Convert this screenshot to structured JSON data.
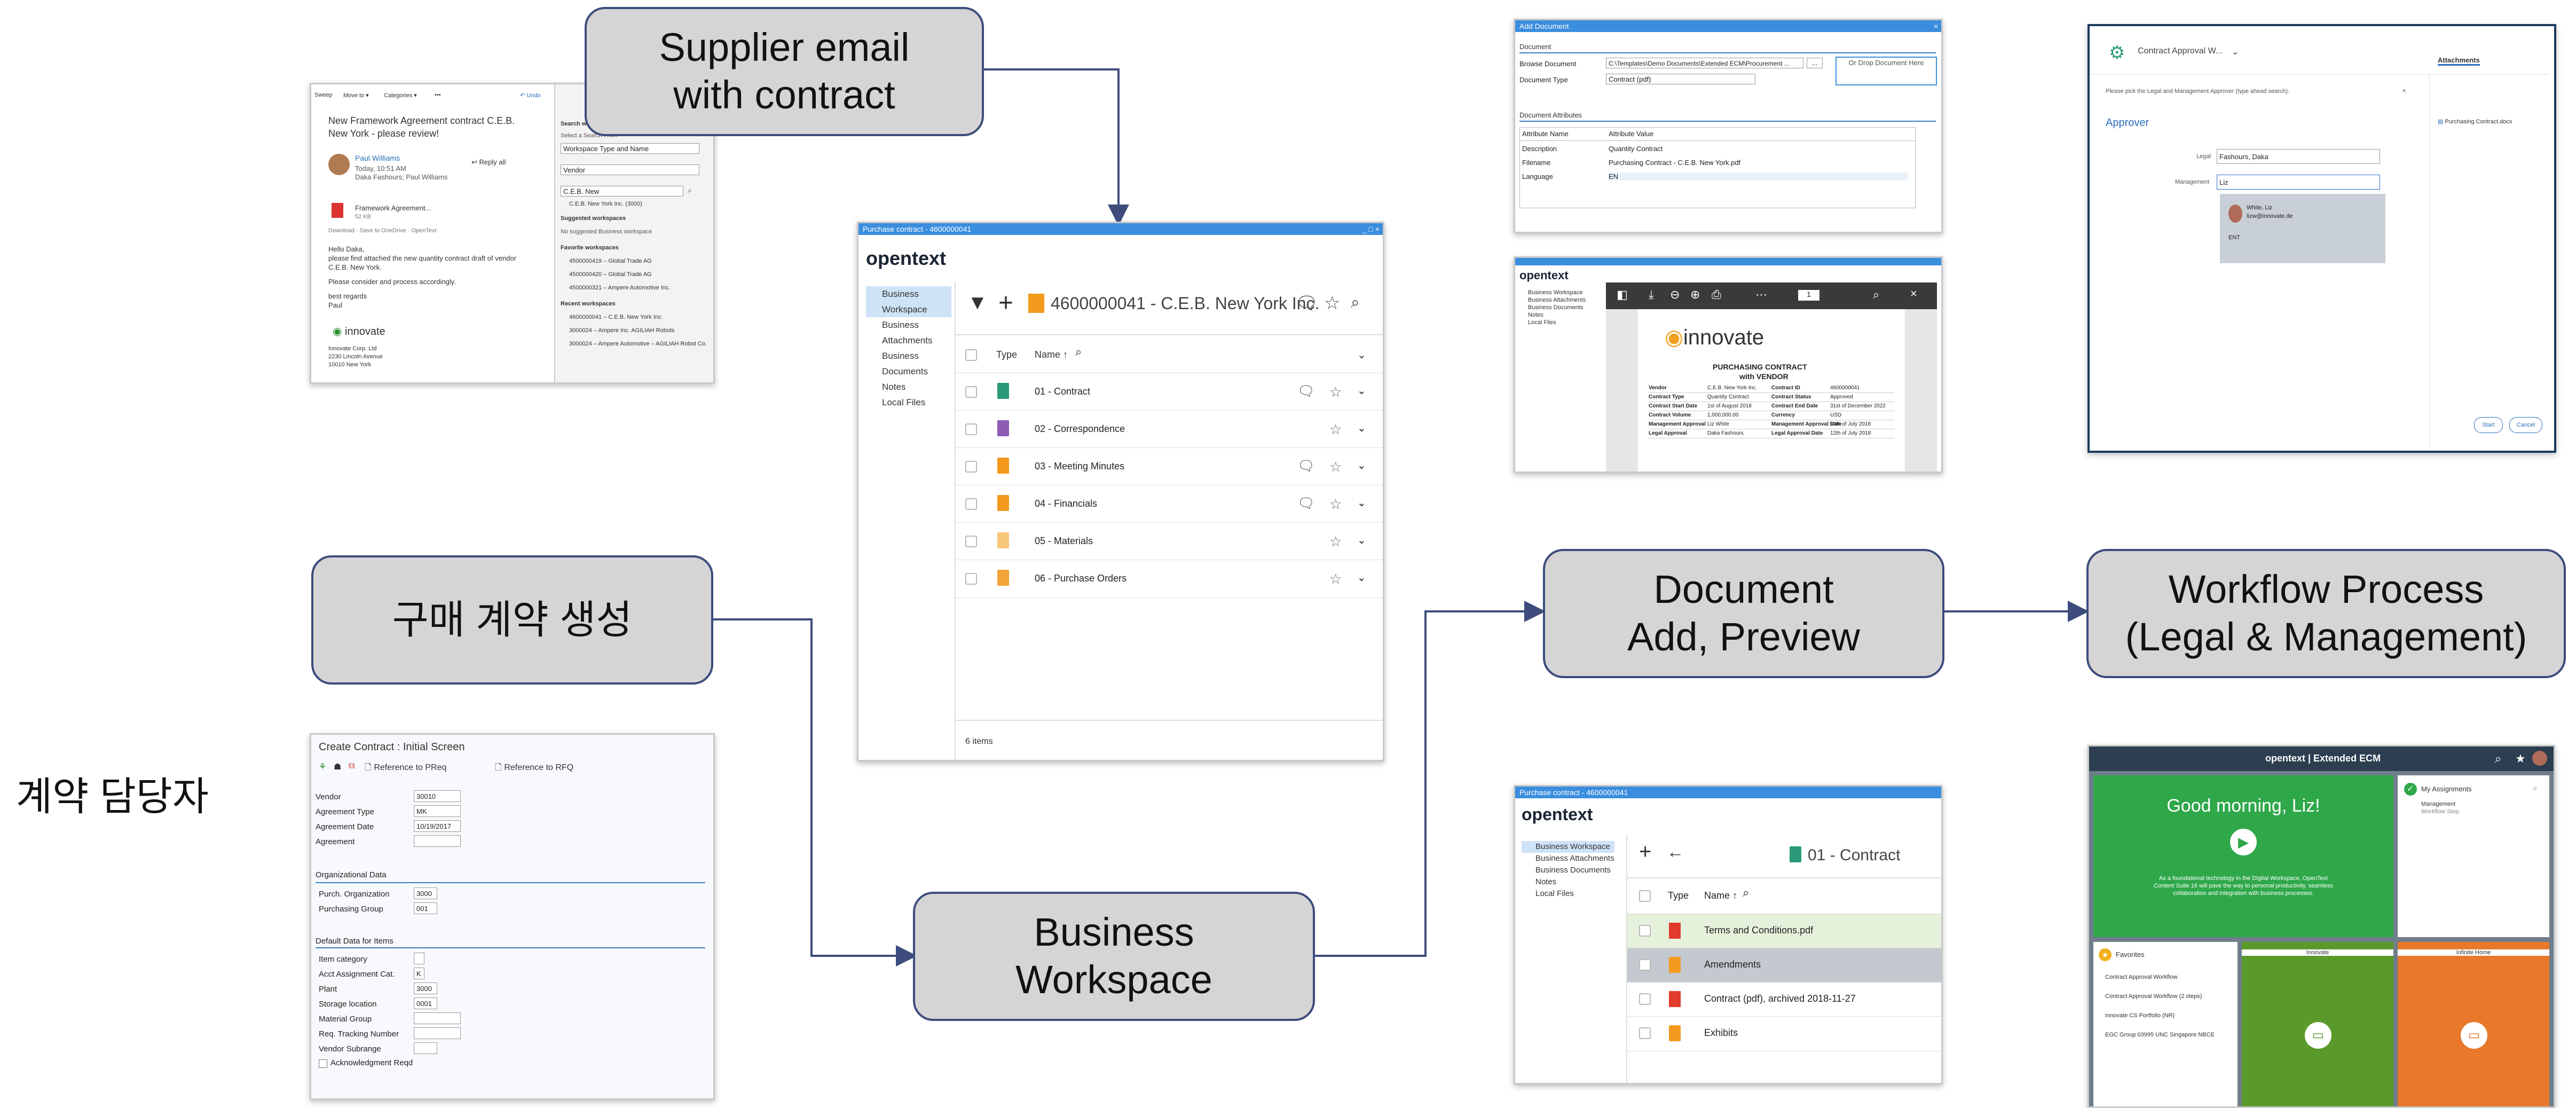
{
  "labels": {
    "supplier_email": "Supplier email\nwith contract",
    "create_contract": "구매 계약 생성",
    "business_workspace": "Business\nWorkspace",
    "doc_add_preview": "Document\nAdd, Preview",
    "workflow": "Workflow Process\n(Legal & Management)",
    "actor": "계약 담당자"
  },
  "outlook": {
    "toolbar": [
      "Sweep",
      "Move to ▾",
      "Categories ▾",
      "•••",
      "↶ Undo"
    ],
    "subject": "New Framework Agreement contract C.E.B. New York - please review!",
    "sender": "Paul Williams",
    "sent": "Today, 10:51 AM",
    "recipients": "Daka Fashours; Paul Williams",
    "reply_all": "Reply all",
    "attachment_name": "Framework Agreement...",
    "attachment_size": "52 KB",
    "attachment_actions": "Download · Save to OneDrive · OpenText",
    "body": [
      "Hello Daka,",
      "please find attached the new quantity contract draft of vendor C.E.B. New York.",
      "Please consider and process accordingly.",
      "best regards",
      "Paul"
    ],
    "signature_logo": "innovate",
    "signature_lines": [
      "Innovate Corp. Ltd",
      "2230 Lincoln Avenue",
      "10010 New York"
    ],
    "side_panel": {
      "search_title": "Search workspaces",
      "search_from": "Select a Search From",
      "ws_type_select": "Workspace Type and Name",
      "vendor_select": "Vendor",
      "search_value": "C.E.B. New",
      "result_1": "C.E.B. New York Inc. (3000)",
      "suggested": "Suggested workspaces",
      "no_suggested": "No suggested Business workspace",
      "favorites": "Favorite workspaces",
      "fav_items": [
        "4500000419 – Global Trade AG",
        "4500000420 – Global Trade AG",
        "4500000321 – Ampere Automotive Inc."
      ],
      "recent": "Recent workspaces",
      "recent_items": [
        "4600000041 – C.E.B. New York Inc.",
        "3000024 – Ampere Inc. AGILIAH Robots",
        "3000024 – Ampere Automotive – AGILIAH Robot Co."
      ]
    }
  },
  "sap": {
    "title": "Create Contract : Initial Screen",
    "ref_preq": "Reference to PReq",
    "ref_rfq": "Reference to RFQ",
    "fields": [
      {
        "label": "Vendor",
        "value": "30010"
      },
      {
        "label": "Agreement Type",
        "value": "MK"
      },
      {
        "label": "Agreement Date",
        "value": "10/19/2017"
      },
      {
        "label": "Agreement",
        "value": ""
      }
    ],
    "org_header": "Organizational Data",
    "org_fields": [
      {
        "label": "Purch. Organization",
        "value": "3000"
      },
      {
        "label": "Purchasing Group",
        "value": "001"
      }
    ],
    "default_header": "Default Data for Items",
    "default_fields": [
      {
        "label": "Item category",
        "value": ""
      },
      {
        "label": "Acct Assignment Cat.",
        "value": "K"
      },
      {
        "label": "Plant",
        "value": "3000"
      },
      {
        "label": "Storage location",
        "value": "0001"
      },
      {
        "label": "Material Group",
        "value": ""
      },
      {
        "label": "Req. Tracking Number",
        "value": ""
      },
      {
        "label": "Vendor Subrange",
        "value": ""
      }
    ],
    "ack_label": "Acknowledgment Reqd"
  },
  "workspace_main": {
    "window_title": "Purchase contract - 4600000041",
    "logo": "opentext",
    "tree": [
      "Business Workspace",
      "Business Attachments",
      "Business Documents",
      "Notes",
      "Local Files"
    ],
    "ws_title": "4600000041 - C.E.B. New York Inc.",
    "col_type": "Type",
    "col_name": "Name ↑",
    "items": [
      "01 - Contract",
      "02 - Correspondence",
      "03 - Meeting Minutes",
      "04 - Financials",
      "05 - Materials",
      "06 - Purchase Orders"
    ],
    "footer": "6 items"
  },
  "add_document": {
    "window_title": "Add Document",
    "section": "Document",
    "browse_label": "Browse Document",
    "browse_value": "C:\\Templates\\Demo Documents\\Extended ECM\\Procurement ...",
    "browse_btn": "...",
    "drop_hint": "Or Drop Document Here",
    "type_label": "Document Type",
    "type_value": "Contract (pdf)",
    "attrs_section": "Document Attributes",
    "attr_col_name": "Attribute Name",
    "attr_col_value": "Attribute Value",
    "attrs": [
      {
        "name": "Description",
        "value": "Quantity Contract"
      },
      {
        "name": "Filename",
        "value": "Purchasing Contract - C.E.B. New York.pdf"
      },
      {
        "name": "Language",
        "value": "EN"
      }
    ]
  },
  "preview": {
    "logo": "opentext",
    "tree": [
      "Business Workspace",
      "Business Attachments",
      "Business Documents",
      "Notes",
      "Local Files"
    ],
    "zoom": "1",
    "doc_logo": "innovate",
    "doc_title_1": "PURCHASING CONTRACT",
    "doc_title_2": "with VENDOR",
    "table": [
      [
        "Vendor",
        "C.E.B. New York Inc.",
        "Contract ID",
        "4600000041"
      ],
      [
        "Contract Type",
        "Quantity Contract",
        "Contract Status",
        "Approved"
      ],
      [
        "Contract Start Date",
        "1st of August 2018",
        "Contract End Date",
        "31st of December 2022"
      ],
      [
        "Contract Volume",
        "1,000,000.00",
        "Currency",
        "USD"
      ],
      [
        "Management Approval",
        "Liz White",
        "Management Approval Date",
        "10th of July 2018"
      ],
      [
        "Legal Approval",
        "Daka Fashours",
        "Legal Approval Date",
        "12th of July 2018"
      ]
    ]
  },
  "workspace_contract": {
    "window_title": "Purchase contract - 4600000041",
    "logo": "opentext",
    "tree": [
      "Business Workspace",
      "Business Attachments",
      "Business Documents",
      "Notes",
      "Local Files"
    ],
    "folder_title": "01 - Contract",
    "col_type": "Type",
    "col_name": "Name ↑",
    "items": [
      "Terms and Conditions.pdf",
      "Amendments",
      "Contract (pdf), archived 2018-11-27",
      "Exhibits"
    ]
  },
  "workflow_dialog": {
    "title": "Contract Approval W...",
    "attachments_tab": "Attachments",
    "instruction": "Please pick the Legal and Management Approver (type ahead search).",
    "approver_header": "Approver",
    "legal_label": "Legal",
    "legal_value": "Fashours, Daka",
    "mgmt_label": "Management",
    "mgmt_value": "Liz",
    "suggestion_name": "White, Liz",
    "suggestion_mail": "lizw@innovate.de",
    "suggestion_org": "ENT",
    "attachment_item": "Purchasing Contract.docx",
    "start_btn": "Start",
    "cancel_btn": "Cancel"
  },
  "ecm_home": {
    "brand": "opentext | Extended ECM",
    "greeting": "Good morning, Liz!",
    "tagline": "As a foundational technology in the Digital Workspace, OpenText Content Suite 16 will pave the way to personal productivity, seamless collaboration and integration with business processes.",
    "assignments_title": "My Assignments",
    "assignment_item": "Management",
    "assignment_sub": "Workflow Step",
    "favorites_title": "Favorites",
    "fav_items": [
      "Contract Approval Workflow",
      "Contract Approval Workflow (2 steps)",
      "Innovate CS Portfolio (NR)",
      "EGC Group 03995 UNC Singapore NBCE"
    ],
    "tile_innovate": "Innovate",
    "tile_home": "Infinite Home"
  },
  "colors": {
    "label_fill": "#d5d5d5",
    "label_border": "#3d4c7d",
    "connector": "#3d4c7d",
    "titlebar": "#3b8ede",
    "folder": "#f39a1e"
  }
}
